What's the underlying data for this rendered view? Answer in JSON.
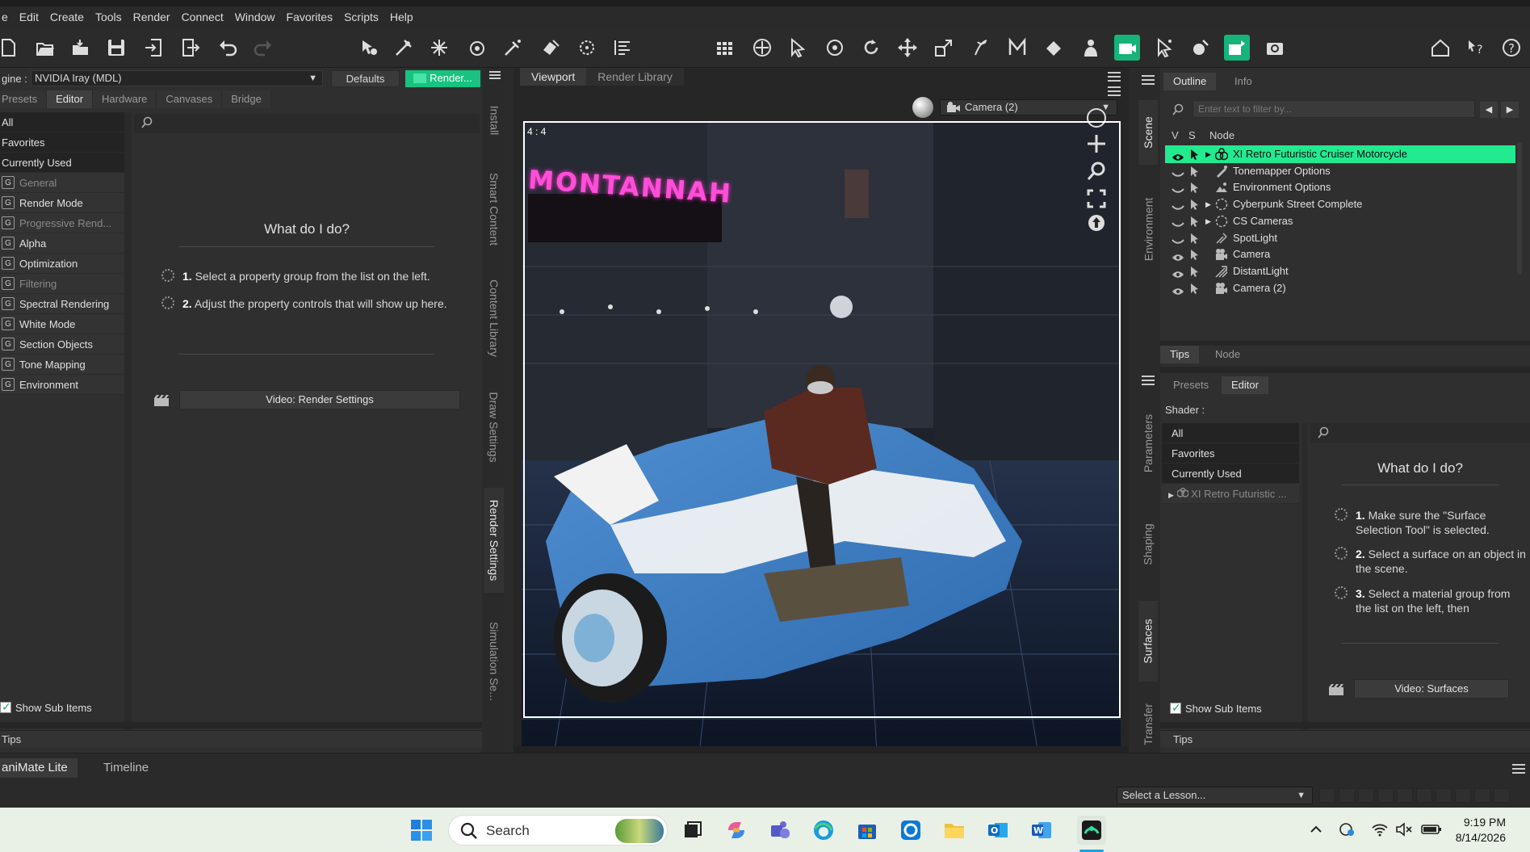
{
  "menubar": [
    "e",
    "Edit",
    "Create",
    "Tools",
    "Render",
    "Connect",
    "Window",
    "Favorites",
    "Scripts",
    "Help"
  ],
  "left": {
    "engine_label": "gine :",
    "engine_value": "NVIDIA Iray (MDL)",
    "defaults_label": "Defaults",
    "render_label": "Render...",
    "tabs": [
      "Presets",
      "Editor",
      "Hardware",
      "Canvases",
      "Bridge"
    ],
    "active_tab": "Editor",
    "heads": [
      "All",
      "Favorites",
      "Currently Used"
    ],
    "groups": [
      "General",
      "Render Mode",
      "Progressive Rend...",
      "Alpha",
      "Optimization",
      "Filtering",
      "Spectral Rendering",
      "White Mode",
      "Section Objects",
      "Tone Mapping",
      "Environment"
    ],
    "help_title": "What do I do?",
    "step1_num": "1.",
    "step1_text": "Select a property group from the list on the left.",
    "step2_num": "2.",
    "step2_text": "Adjust the property controls that will show up here.",
    "video_label": "Video: Render Settings",
    "show_sub_items": "Show Sub Items",
    "tips": "Tips",
    "vtabs": [
      "Install",
      "Smart Content",
      "Content Library",
      "Draw Settings",
      "Render Settings",
      "Simulation Se..."
    ]
  },
  "viewport": {
    "tabs": [
      "Viewport",
      "Render Library"
    ],
    "camera": "Camera (2)",
    "ratio": "4 : 4",
    "sign_text": "MONTANNAH"
  },
  "right": {
    "vtabs_top": [
      "Scene",
      "Environment"
    ],
    "vtabs_bottom": [
      "Parameters",
      "Shaping",
      "Surfaces",
      "Transfer"
    ],
    "outline_tabs": [
      "Outline",
      "Info"
    ],
    "filter_placeholder": "Enter text to filter by...",
    "col_v": "V",
    "col_s": "S",
    "col_node": "Node",
    "nodes": [
      {
        "label": "XI Retro Futuristic Cruiser Motorcycle",
        "expand": true,
        "icon": "figure-icon"
      },
      {
        "label": "Tonemapper Options",
        "expand": false,
        "icon": "tonemapper-icon"
      },
      {
        "label": "Environment Options",
        "expand": false,
        "icon": "environment-icon"
      },
      {
        "label": "Cyberpunk Street Complete",
        "expand": true,
        "icon": "group-icon"
      },
      {
        "label": "CS Cameras",
        "expand": true,
        "icon": "group-icon"
      },
      {
        "label": "SpotLight",
        "expand": false,
        "icon": "spotlight-icon"
      },
      {
        "label": "Camera",
        "expand": false,
        "icon": "camera-icon"
      },
      {
        "label": "DistantLight",
        "expand": false,
        "icon": "distantlight-icon"
      },
      {
        "label": "Camera (2)",
        "expand": false,
        "icon": "camera-icon"
      }
    ],
    "tips_tabs": [
      "Tips",
      "Node"
    ],
    "surf_tabs": [
      "Presets",
      "Editor"
    ],
    "shader_label": "Shader :",
    "surf_list": [
      "All",
      "Favorites",
      "Currently Used"
    ],
    "surf_sub": "XI Retro Futuristic ...",
    "help_title": "What do I do?",
    "step1_num": "1.",
    "step1_text": "Make sure the \"Surface Selection Tool\" is selected.",
    "step2_num": "2.",
    "step2_text": "Select a surface on an object in the scene.",
    "step3_num": "3.",
    "step3_text": "Select a material group from the list on the left, then",
    "video_label": "Video: Surfaces",
    "show_sub_items": "Show Sub Items",
    "tips": "Tips"
  },
  "bottom": {
    "tabs": [
      "aniMate Lite",
      "Timeline"
    ],
    "lesson": "Select a Lesson..."
  },
  "taskbar": {
    "search": "Search",
    "time": "9:19 PM",
    "date": "8/14/2026"
  },
  "colors": {
    "accent": "#17c37f",
    "selection": "#22ea8f",
    "panel": "#2f2f2f"
  }
}
